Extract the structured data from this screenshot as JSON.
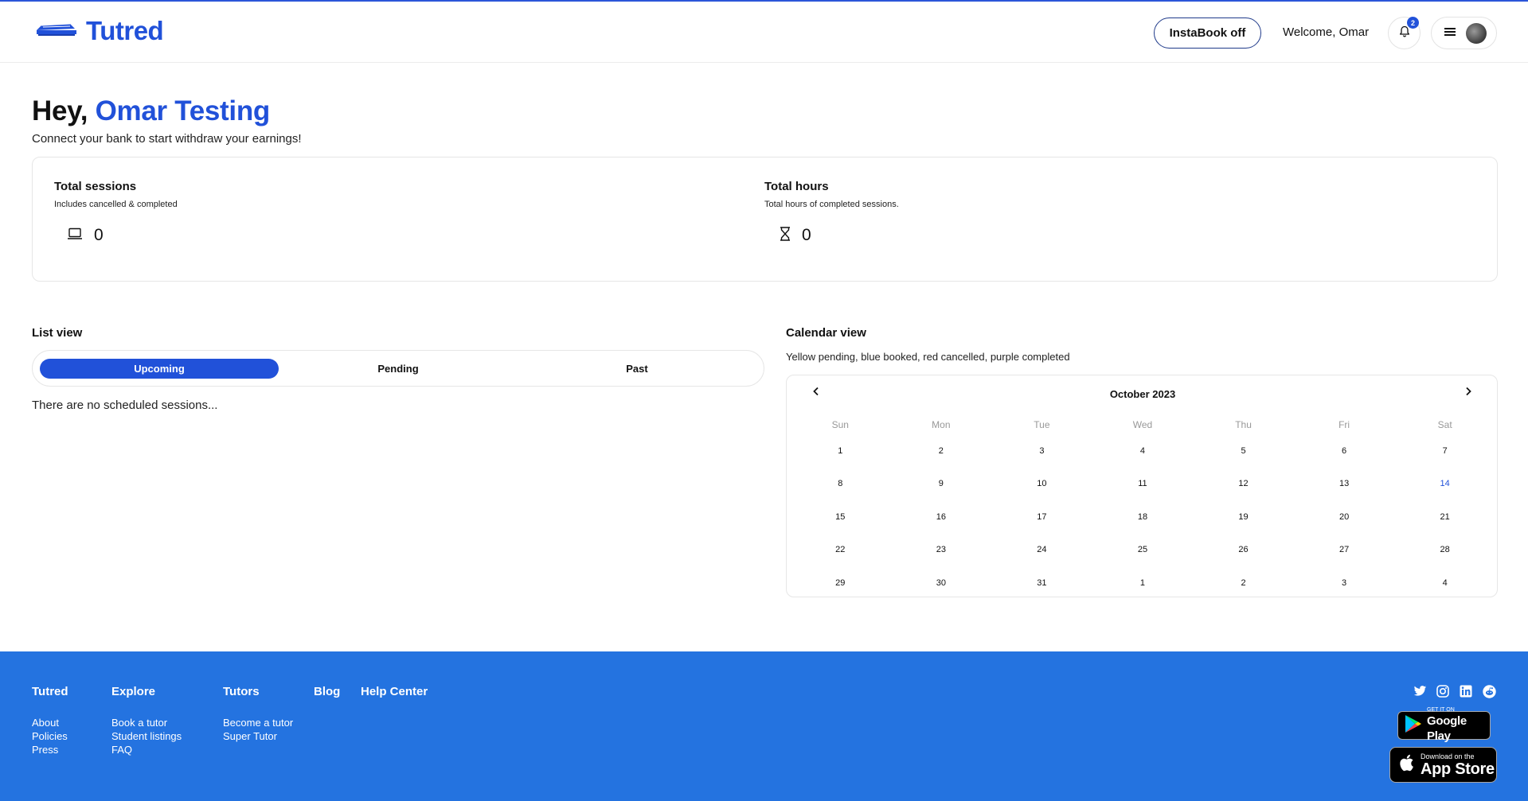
{
  "header": {
    "brand": "Tutred",
    "instabook_label": "InstaBook off",
    "welcome_text": "Welcome, Omar",
    "notification_count": "2"
  },
  "greeting": {
    "prefix": "Hey,",
    "name": "Omar Testing",
    "subtext": "Connect your bank to start withdraw your earnings!"
  },
  "stats": {
    "sessions": {
      "title": "Total sessions",
      "subtitle": "Includes cancelled & completed",
      "value": "0",
      "icon": "laptop-icon"
    },
    "hours": {
      "title": "Total hours",
      "subtitle": "Total hours of completed sessions.",
      "value": "0",
      "icon": "hourglass-icon"
    }
  },
  "list_view": {
    "title": "List view",
    "tabs": [
      {
        "label": "Upcoming",
        "active": true
      },
      {
        "label": "Pending",
        "active": false
      },
      {
        "label": "Past",
        "active": false
      }
    ],
    "empty_message": "There are no scheduled sessions..."
  },
  "calendar_view": {
    "title": "Calendar view",
    "legend": "Yellow pending, blue booked, red cancelled, purple completed",
    "month_label": "October 2023",
    "weekdays": [
      "Sun",
      "Mon",
      "Tue",
      "Wed",
      "Thu",
      "Fri",
      "Sat"
    ],
    "weeks": [
      [
        "1",
        "2",
        "3",
        "4",
        "5",
        "6",
        "7"
      ],
      [
        "8",
        "9",
        "10",
        "11",
        "12",
        "13",
        "14"
      ],
      [
        "15",
        "16",
        "17",
        "18",
        "19",
        "20",
        "21"
      ],
      [
        "22",
        "23",
        "24",
        "25",
        "26",
        "27",
        "28"
      ],
      [
        "29",
        "30",
        "31",
        "1",
        "2",
        "3",
        "4"
      ]
    ],
    "today": "14"
  },
  "footer": {
    "columns": [
      {
        "heading": "Tutred",
        "links": [
          "About",
          "Policies",
          "Press"
        ]
      },
      {
        "heading": "Explore",
        "links": [
          "Book a tutor",
          "Student listings",
          "FAQ"
        ]
      },
      {
        "heading": "Tutors",
        "links": [
          "Become a tutor",
          "Super Tutor"
        ]
      },
      {
        "heading": "Blog",
        "links": []
      },
      {
        "heading": "Help Center",
        "links": []
      }
    ],
    "social": [
      "twitter-icon",
      "instagram-icon",
      "linkedin-icon",
      "reddit-icon"
    ],
    "google_play": {
      "small": "GET IT ON",
      "big": "Google Play"
    },
    "app_store": {
      "small": "Download on the",
      "big": "App Store"
    }
  },
  "colors": {
    "brand_blue": "#2151d9",
    "footer_blue": "#2473e0"
  }
}
